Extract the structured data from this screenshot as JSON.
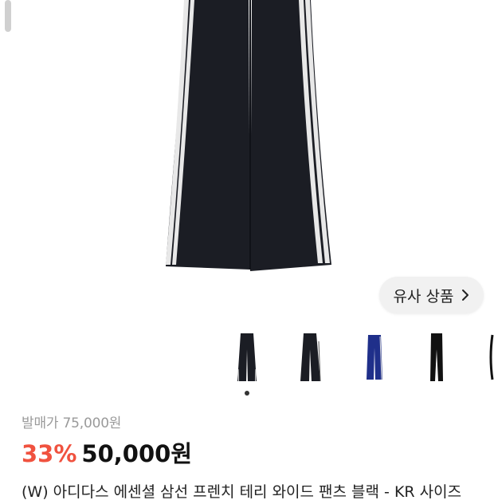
{
  "similar_button": {
    "label": "유사 상품"
  },
  "thumbnails": [
    {
      "name": "thumb-black-wide-1",
      "color": "#1b1d24"
    },
    {
      "name": "thumb-black-wide-2",
      "color": "#1b1d24"
    },
    {
      "name": "thumb-navy",
      "color": "#1f2f8a"
    },
    {
      "name": "thumb-black-slim",
      "color": "#111111"
    }
  ],
  "product": {
    "original_price": "발매가 75,000원",
    "discount": "33%",
    "sale_price": "50,000원",
    "title": "(W) 아디다스 에센셜 삼선 프렌치 테리 와이드 팬츠 블랙 - KR 사이즈"
  },
  "colors": {
    "accent": "#f0523f",
    "pants": "#1b1d24",
    "stripe": "#e8e8e8"
  }
}
